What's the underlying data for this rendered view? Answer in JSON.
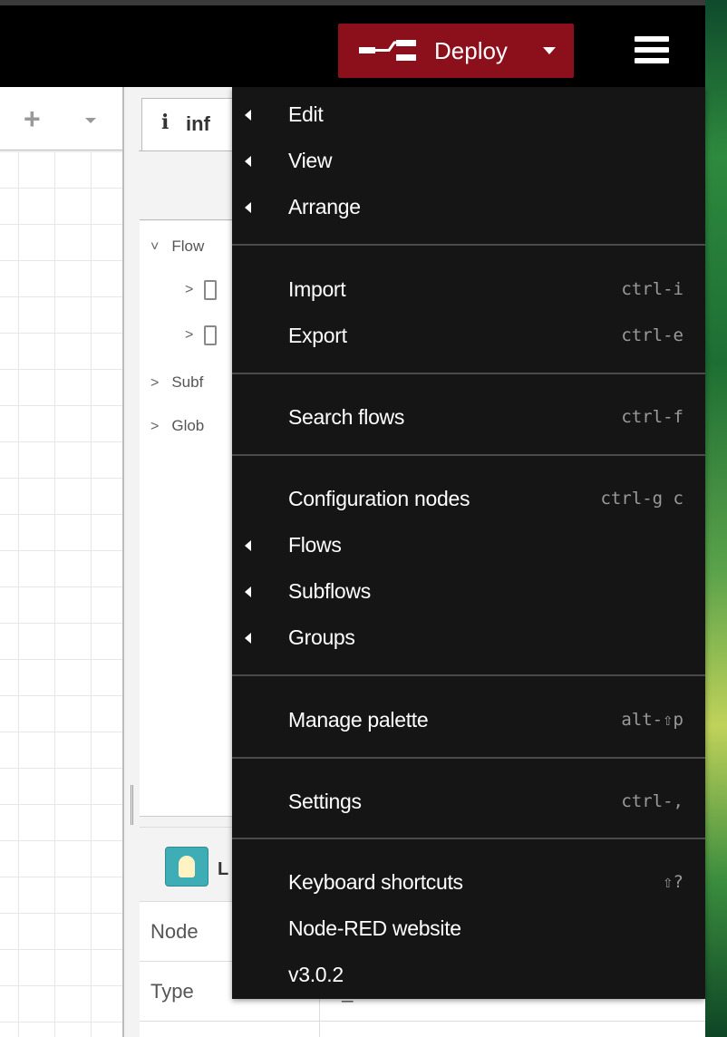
{
  "header": {
    "deploy_label": "Deploy"
  },
  "workspace": {
    "add_tab": "+"
  },
  "sidebar": {
    "tab_icon": "i",
    "tab_label": "inf",
    "tree": [
      {
        "chevron": "˅",
        "label": "Flow"
      },
      {
        "chevron": ">",
        "label": ""
      },
      {
        "chevron": ">",
        "label": ""
      },
      {
        "chevron": ">",
        "label": "Subf"
      },
      {
        "chevron": ">",
        "label": "Glob"
      }
    ],
    "help_title": "L",
    "props": [
      {
        "key": "Node",
        "value": ""
      },
      {
        "key": "Type",
        "value": "ui_led"
      }
    ]
  },
  "menu": {
    "items": [
      {
        "label": "Edit",
        "shortcut": ""
      },
      {
        "label": "View",
        "shortcut": ""
      },
      {
        "label": "Arrange",
        "shortcut": ""
      },
      {
        "label": "Import",
        "shortcut": "ctrl-i"
      },
      {
        "label": "Export",
        "shortcut": "ctrl-e"
      },
      {
        "label": "Search flows",
        "shortcut": "ctrl-f"
      },
      {
        "label": "Configuration nodes",
        "shortcut": "ctrl-g c"
      },
      {
        "label": "Flows",
        "shortcut": ""
      },
      {
        "label": "Subflows",
        "shortcut": ""
      },
      {
        "label": "Groups",
        "shortcut": ""
      },
      {
        "label": "Manage palette",
        "shortcut": "alt-⇧p"
      },
      {
        "label": "Settings",
        "shortcut": "ctrl-,"
      },
      {
        "label": "Keyboard shortcuts",
        "shortcut": "⇧?"
      },
      {
        "label": "Node-RED website",
        "shortcut": ""
      },
      {
        "label": "v3.0.2",
        "shortcut": ""
      }
    ]
  },
  "icons": {
    "deploy": "deploy-icon",
    "hamburger": "hamburger-menu-icon",
    "submenu": "caret-left-icon",
    "info": "info-icon"
  },
  "colors": {
    "deploy_bg": "#8c101c",
    "menu_bg": "#151515",
    "node_icon": "#3fadb5"
  }
}
